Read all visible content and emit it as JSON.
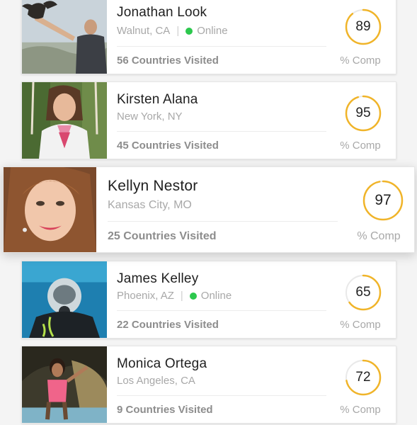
{
  "accent_color": "#f0b429",
  "online_color": "#2cc84d",
  "people": [
    {
      "name": "Jonathan Look",
      "location": "Walnut, CA",
      "status": "Online",
      "countries": "56 Countries Visited",
      "score": "89",
      "completion": 0.89,
      "comp_label": "% Comp",
      "photo_icon": "man-with-bird-photo"
    },
    {
      "name": "Kirsten Alana",
      "location": "New York, NY",
      "status": "",
      "countries": "45 Countries Visited",
      "score": "95",
      "completion": 0.95,
      "comp_label": "% Comp",
      "photo_icon": "woman-on-swing-photo"
    },
    {
      "name": "Kellyn Nestor",
      "location": "Kansas City, MO",
      "status": "",
      "countries": "25 Countries Visited",
      "score": "97",
      "completion": 0.97,
      "comp_label": "% Comp",
      "photo_icon": "woman-portrait-photo"
    },
    {
      "name": "James Kelley",
      "location": "Phoenix, AZ",
      "status": "Online",
      "countries": "22 Countries Visited",
      "score": "65",
      "completion": 0.65,
      "comp_label": "% Comp",
      "photo_icon": "scuba-diver-photo"
    },
    {
      "name": "Monica Ortega",
      "location": "Los Angeles, CA",
      "status": "",
      "countries": "9 Countries Visited",
      "score": "72",
      "completion": 0.72,
      "comp_label": "% Comp",
      "photo_icon": "woman-by-water-photo"
    }
  ]
}
